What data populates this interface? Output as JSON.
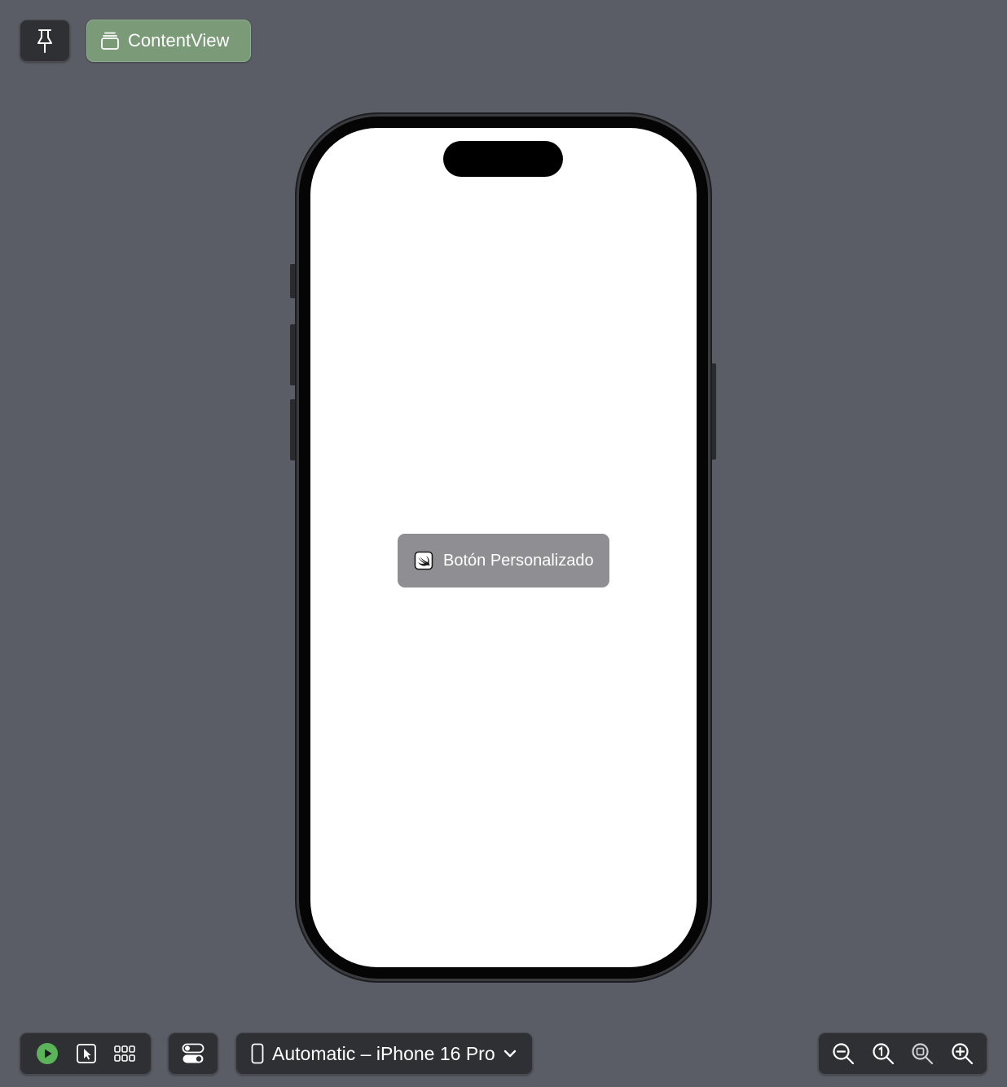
{
  "header": {
    "pin_icon": "pin-icon",
    "tab_icon": "stacked-window-icon",
    "tab_label": "ContentView"
  },
  "canvas": {
    "device_screen_background": "#ffffff",
    "button": {
      "icon": "swift-app-icon",
      "label": "Botón Personalizado",
      "color": "#8e8e93"
    }
  },
  "toolbar": {
    "live_icon": "play-icon",
    "selectable_icon": "cursor-select-icon",
    "variants_icon": "grid-icon",
    "settings_icon": "toggles-icon",
    "device_icon": "iphone-icon",
    "device_label": "Automatic – iPhone 16 Pro",
    "zoom": [
      "zoom-out-icon",
      "zoom-100-icon",
      "zoom-fit-icon",
      "zoom-in-icon"
    ]
  },
  "colors": {
    "background": "#5a5d65",
    "tab_active": "#7a9a78",
    "play_green": "#5bb35a"
  }
}
